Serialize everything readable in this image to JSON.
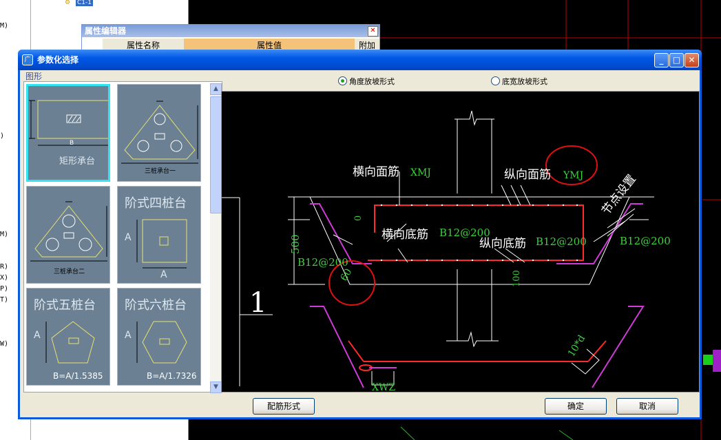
{
  "background": {
    "side_letters": [
      "M)",
      ")",
      "M)",
      "R)",
      "X)",
      "P)",
      "T)",
      "W)"
    ],
    "tree_node": "C1-1",
    "property_editor": {
      "title": "属性编辑器",
      "col_name": "属性名称",
      "col_value": "属性值",
      "col_extra": "附加"
    }
  },
  "dialog": {
    "title": "参数化选择",
    "group_label": "图形",
    "shapes": [
      {
        "label": "矩形承台",
        "sub": "B",
        "selected": true
      },
      {
        "label": "三桩承台一"
      },
      {
        "label": "三桩承台二"
      },
      {
        "label": "阶式四桩台",
        "dim_a": "A",
        "dim_b": "A"
      },
      {
        "label": "阶式五桩台",
        "dim_a": "A",
        "formula": "B=A/1.5385"
      },
      {
        "label": "阶式六桩台",
        "dim_a": "A",
        "formula": "B=A/1.7326"
      }
    ],
    "radio_options": [
      {
        "label": "角度放坡形式",
        "checked": true
      },
      {
        "label": "底宽放坡形式",
        "checked": false
      }
    ],
    "diagram": {
      "lbl_hengxiang_mian": "横向面筋",
      "code_xmj": "XMJ",
      "lbl_zongxiang_mian": "纵向面筋",
      "code_ymj": "YMJ",
      "lbl_node": "节点设置",
      "lbl_hengxiang_di": "横向底筋",
      "val_heng_di": "B12@200",
      "lbl_zongxiang_di": "纵向底筋",
      "val_zong_di": "B12@200",
      "val_right": "B12@200",
      "val_left": "B12@200",
      "dim_500": "500",
      "dim_0": "0",
      "dim_100": "100",
      "angle_60": "60",
      "dim_10d": "10*d",
      "code_xwz": "XWZ",
      "section_mark": "1"
    },
    "buttons": {
      "rebar_form": "配筋形式",
      "ok": "确定",
      "cancel": "取消"
    }
  },
  "colors": {
    "dialog_blue": "#0058e6",
    "selection_cyan": "#34e3f0",
    "rebar_red": "#ff2a2a",
    "rebar_magenta": "#d03ad8",
    "label_green": "#3fd03f",
    "highlight_circle": "#e01010"
  }
}
